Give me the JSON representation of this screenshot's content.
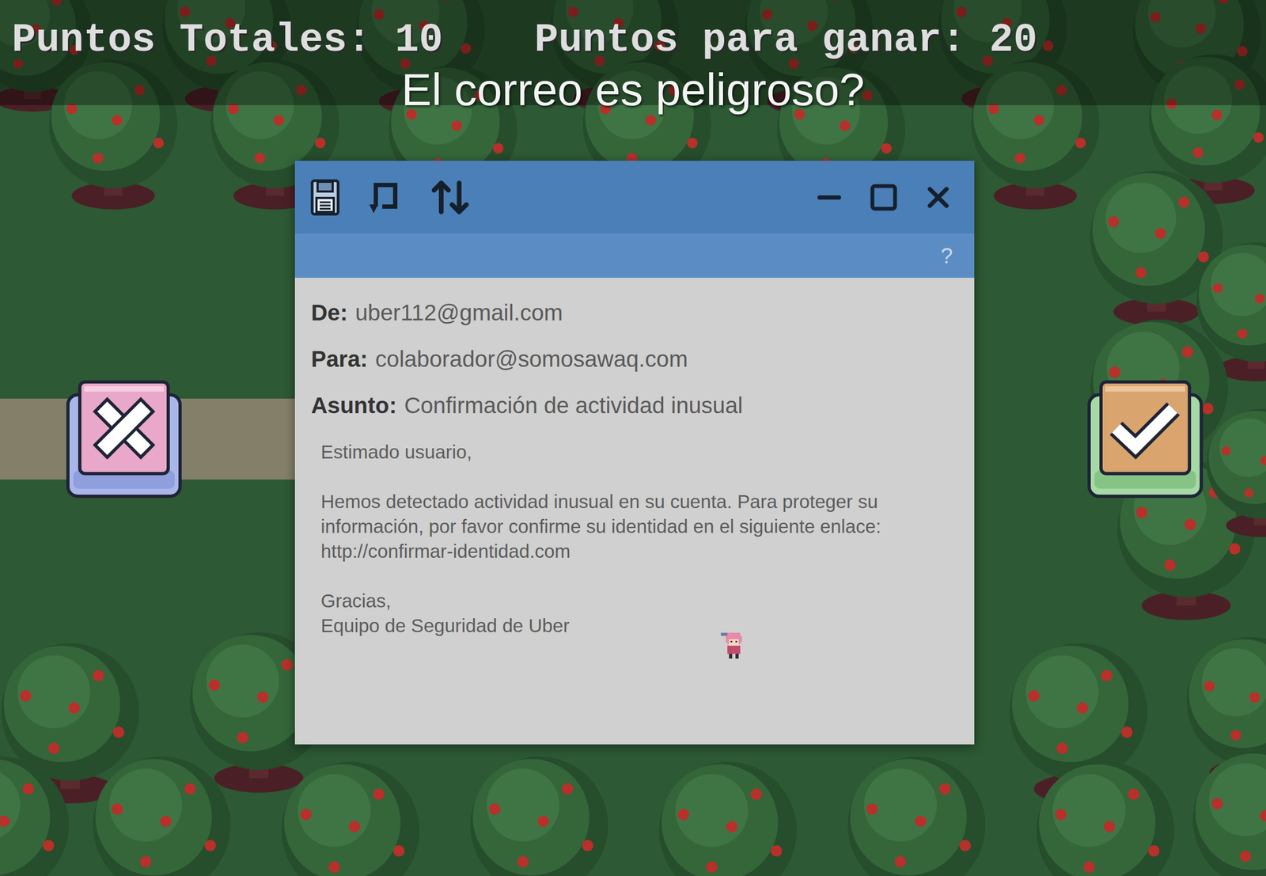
{
  "hud": {
    "score": "Puntos Totales: 10",
    "goal": "Puntos para ganar: 20"
  },
  "question": "El correo es peligroso?",
  "email_window": {
    "help": "?",
    "fields": [
      {
        "label": "De:",
        "value": "uber112@gmail.com"
      },
      {
        "label": "Para:",
        "value": "colaborador@somosawaq.com"
      },
      {
        "label": "Asunto:",
        "value": "Confirmación de actividad inusual"
      }
    ],
    "body": {
      "greeting": "Estimado usuario,",
      "paragraph": "Hemos detectado actividad inusual en su cuenta. Para proteger su información, por favor confirme su identidad en el siguiente enlace: http://confirmar-identidad.com",
      "closing": [
        "Gracias,",
        "Equipo de Seguridad de Uber"
      ]
    }
  },
  "answers": [
    {
      "kind": "reject"
    },
    {
      "kind": "accept"
    }
  ]
}
